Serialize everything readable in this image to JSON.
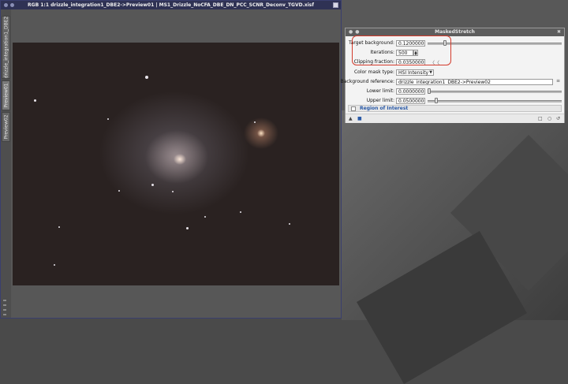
{
  "image_window": {
    "title": "RGB 1:1 drizzle_integration1_DBE2->Preview01 | MS1_Drizzle_NoCFA_DBE_DN_PCC_SCNR_Deconv_TGVD.xisf",
    "tabs": [
      {
        "label": "drizzle_integration1_DBE2"
      },
      {
        "label": "Preview01"
      },
      {
        "label": "Preview02"
      }
    ]
  },
  "masked_stretch": {
    "title": "MaskedStretch",
    "target_background": {
      "label": "Target background:",
      "value": "0.12000000",
      "slider": 0.12
    },
    "iterations": {
      "label": "Iterations:",
      "value": "500"
    },
    "clipping_fraction": {
      "label": "Clipping fraction:",
      "value": "0.03500000"
    },
    "color_mask_type": {
      "label": "Color mask type:",
      "value": "HSI Intensity"
    },
    "background_reference": {
      "label": "Background reference:",
      "value": "drizzle_integration1_DBE2->Preview02"
    },
    "lower_limit": {
      "label": "Lower limit:",
      "value": "0.00000000",
      "slider": 0.0
    },
    "upper_limit": {
      "label": "Upper limit:",
      "value": "0.05000000",
      "slider": 0.05
    },
    "region_of_interest": {
      "label": "Region of Interest",
      "checked": false
    }
  },
  "colors": {
    "titlebar": "#2f3254",
    "highlight": "#d33b2c",
    "roi_label": "#2a5aa8"
  }
}
